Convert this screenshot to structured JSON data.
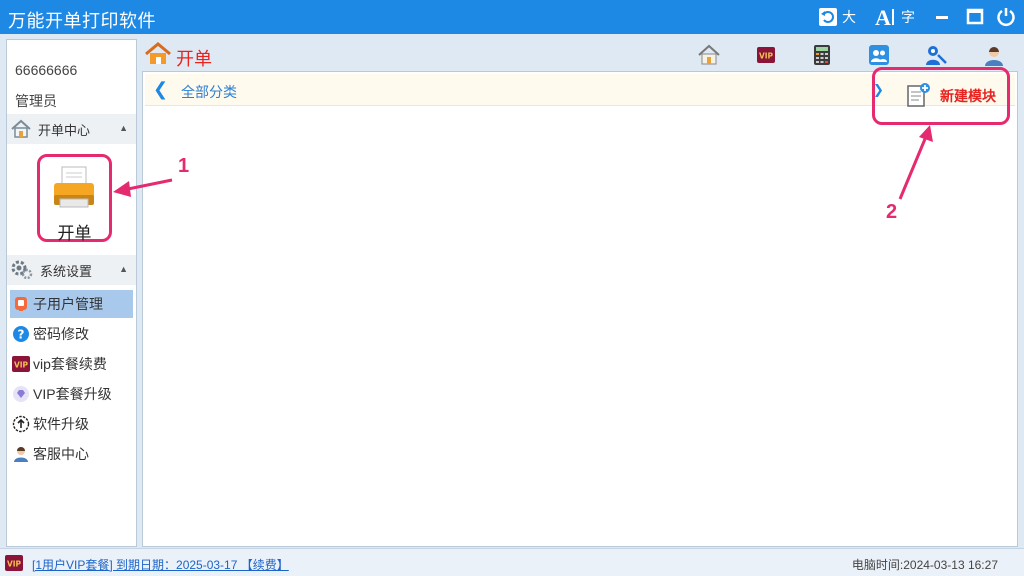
{
  "window": {
    "title": "万能开单打印软件",
    "font_size_big_label": "大",
    "font_label": "字"
  },
  "sidebar": {
    "user_id": "66666666",
    "user_role": "管理员",
    "section_order": {
      "label": "开单中心"
    },
    "order_tile": {
      "label": "开单"
    },
    "section_settings": {
      "label": "系统设置"
    },
    "items": [
      {
        "label": "子用户管理",
        "icon": "sub-user-icon",
        "active": true
      },
      {
        "label": "密码修改",
        "icon": "question-icon",
        "active": false
      },
      {
        "label": "vip套餐续费",
        "icon": "vip-icon",
        "active": false
      },
      {
        "label": "VIP套餐升级",
        "icon": "diamond-icon",
        "active": false
      },
      {
        "label": "软件升级",
        "icon": "upgrade-icon",
        "active": false
      },
      {
        "label": "客服中心",
        "icon": "support-icon",
        "active": false
      }
    ]
  },
  "main": {
    "title": "开单",
    "toolbar_icons": [
      "home-icon",
      "vip-icon",
      "calculator-icon",
      "users-icon",
      "key-user-icon",
      "support-icon"
    ],
    "breadcrumb": "全部分类",
    "new_module_label": "新建模块"
  },
  "annotations": {
    "one": "1",
    "two": "2"
  },
  "status": {
    "vip_text": "[1用户VIP套餐] 到期日期：2025-03-17 【续费】",
    "clock": "电脑时间:2024-03-13 16:27"
  },
  "colors": {
    "brand": "#1e88e5",
    "accent_red": "#e8231f",
    "annotation": "#e52a6f"
  }
}
